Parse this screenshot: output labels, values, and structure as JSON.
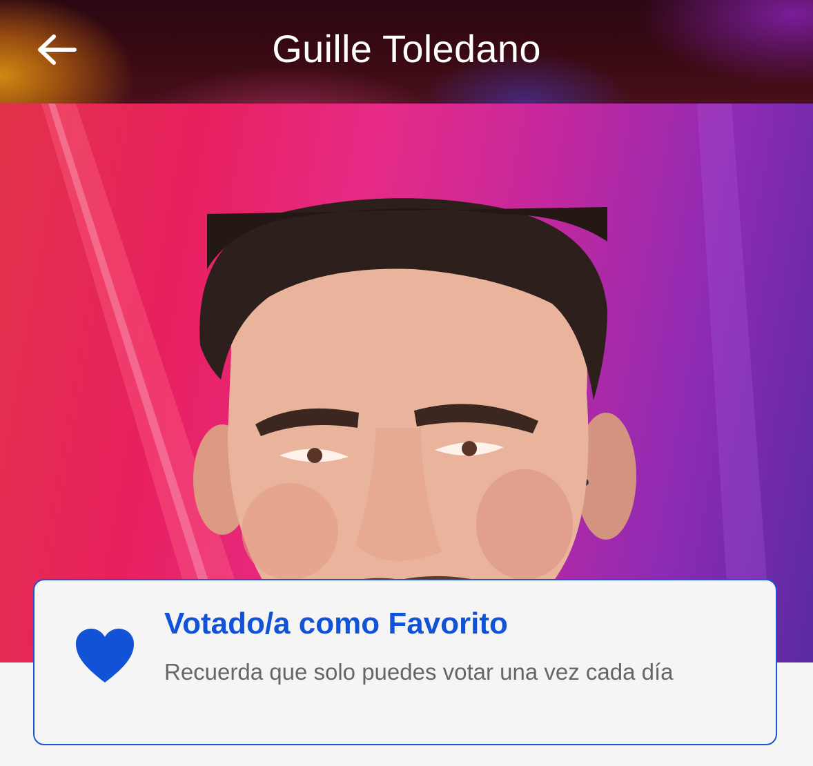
{
  "header": {
    "title": "Guille Toledano",
    "back_icon": "arrow-left-icon"
  },
  "hero": {
    "subject": "contestant-portrait",
    "background_colors": [
      "#e8205e",
      "#c3289e",
      "#5a2aa0"
    ]
  },
  "vote_card": {
    "icon": "heart-icon",
    "title": "Votado/a como Favorito",
    "message": "Recuerda que solo puedes votar una vez cada día",
    "accent_color": "#1152d6"
  }
}
